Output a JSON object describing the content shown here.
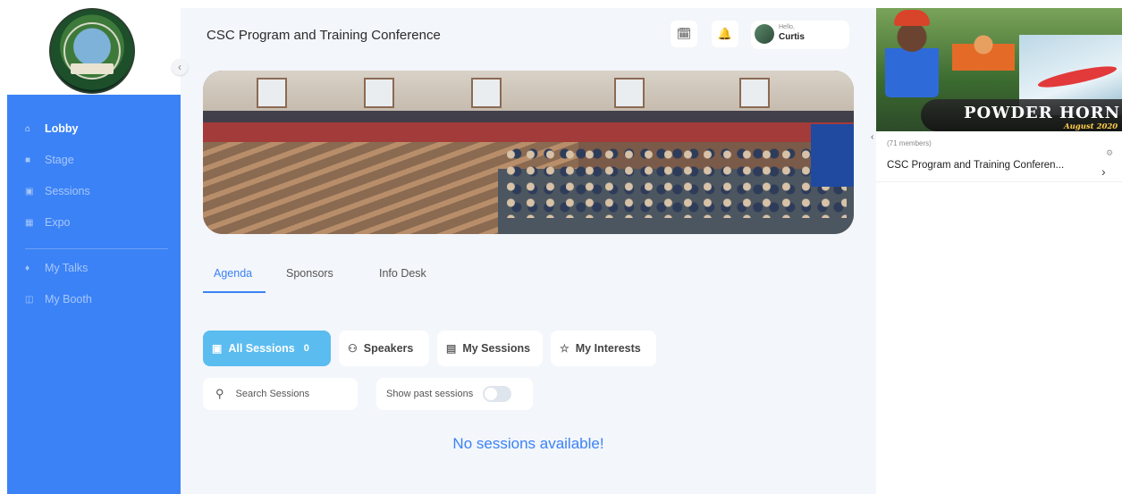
{
  "sidebar": {
    "logo_icon": "adventure-logo",
    "collapse_icon": "chevron-left-icon",
    "items": [
      {
        "label": "Lobby",
        "icon": "home-icon",
        "glyph": "⌂",
        "active": true
      },
      {
        "label": "Stage",
        "icon": "video-icon",
        "glyph": "■",
        "active": false
      },
      {
        "label": "Sessions",
        "icon": "calendar-icon",
        "glyph": "▣",
        "active": false
      },
      {
        "label": "Expo",
        "icon": "grid-icon",
        "glyph": "▦",
        "active": false
      },
      {
        "label": "My Talks",
        "icon": "mic-icon",
        "glyph": "♦",
        "active": false
      },
      {
        "label": "My Booth",
        "icon": "booth-icon",
        "glyph": "◫",
        "active": false
      }
    ]
  },
  "header": {
    "title": "CSC Program and Training Conference",
    "calendar_icon": "calendar-icon",
    "calendar_glyph": "🗓",
    "bell_icon": "bell-icon",
    "bell_glyph": "🔔",
    "greeting": "Hello,",
    "user_name": "Curtis"
  },
  "tabs": [
    {
      "label": "Agenda",
      "active": true
    },
    {
      "label": "Sponsors",
      "active": false
    },
    {
      "label": "Info Desk",
      "active": false
    }
  ],
  "filters": [
    {
      "label": "All Sessions",
      "icon": "calendar-icon",
      "glyph": "▣",
      "count": "0",
      "active": true
    },
    {
      "label": "Speakers",
      "icon": "people-icon",
      "glyph": "⚇",
      "count": "",
      "active": false
    },
    {
      "label": "My Sessions",
      "icon": "document-icon",
      "glyph": "▤",
      "count": "",
      "active": false
    },
    {
      "label": "My Interests",
      "icon": "star-icon",
      "glyph": "☆",
      "count": "",
      "active": false
    }
  ],
  "search": {
    "icon": "search-icon",
    "glyph": "⚲",
    "placeholder": "Search Sessions"
  },
  "past_sessions": {
    "label": "Show past sessions",
    "enabled": false
  },
  "empty_message": "No sessions available!",
  "right_panel": {
    "promo_title": "POWDER HORN",
    "promo_subtitle": "August 2020",
    "members": "(71 members)",
    "conference_name": "CSC Program and Training Conferen...",
    "collapse_glyph": "‹",
    "next_glyph": "›",
    "settings_glyph": "⚙"
  },
  "colors": {
    "accent": "#3b82f6",
    "sidebar": "#3b82f6",
    "active_filter": "#5bbcf0",
    "main_bg": "#f3f6fa"
  }
}
